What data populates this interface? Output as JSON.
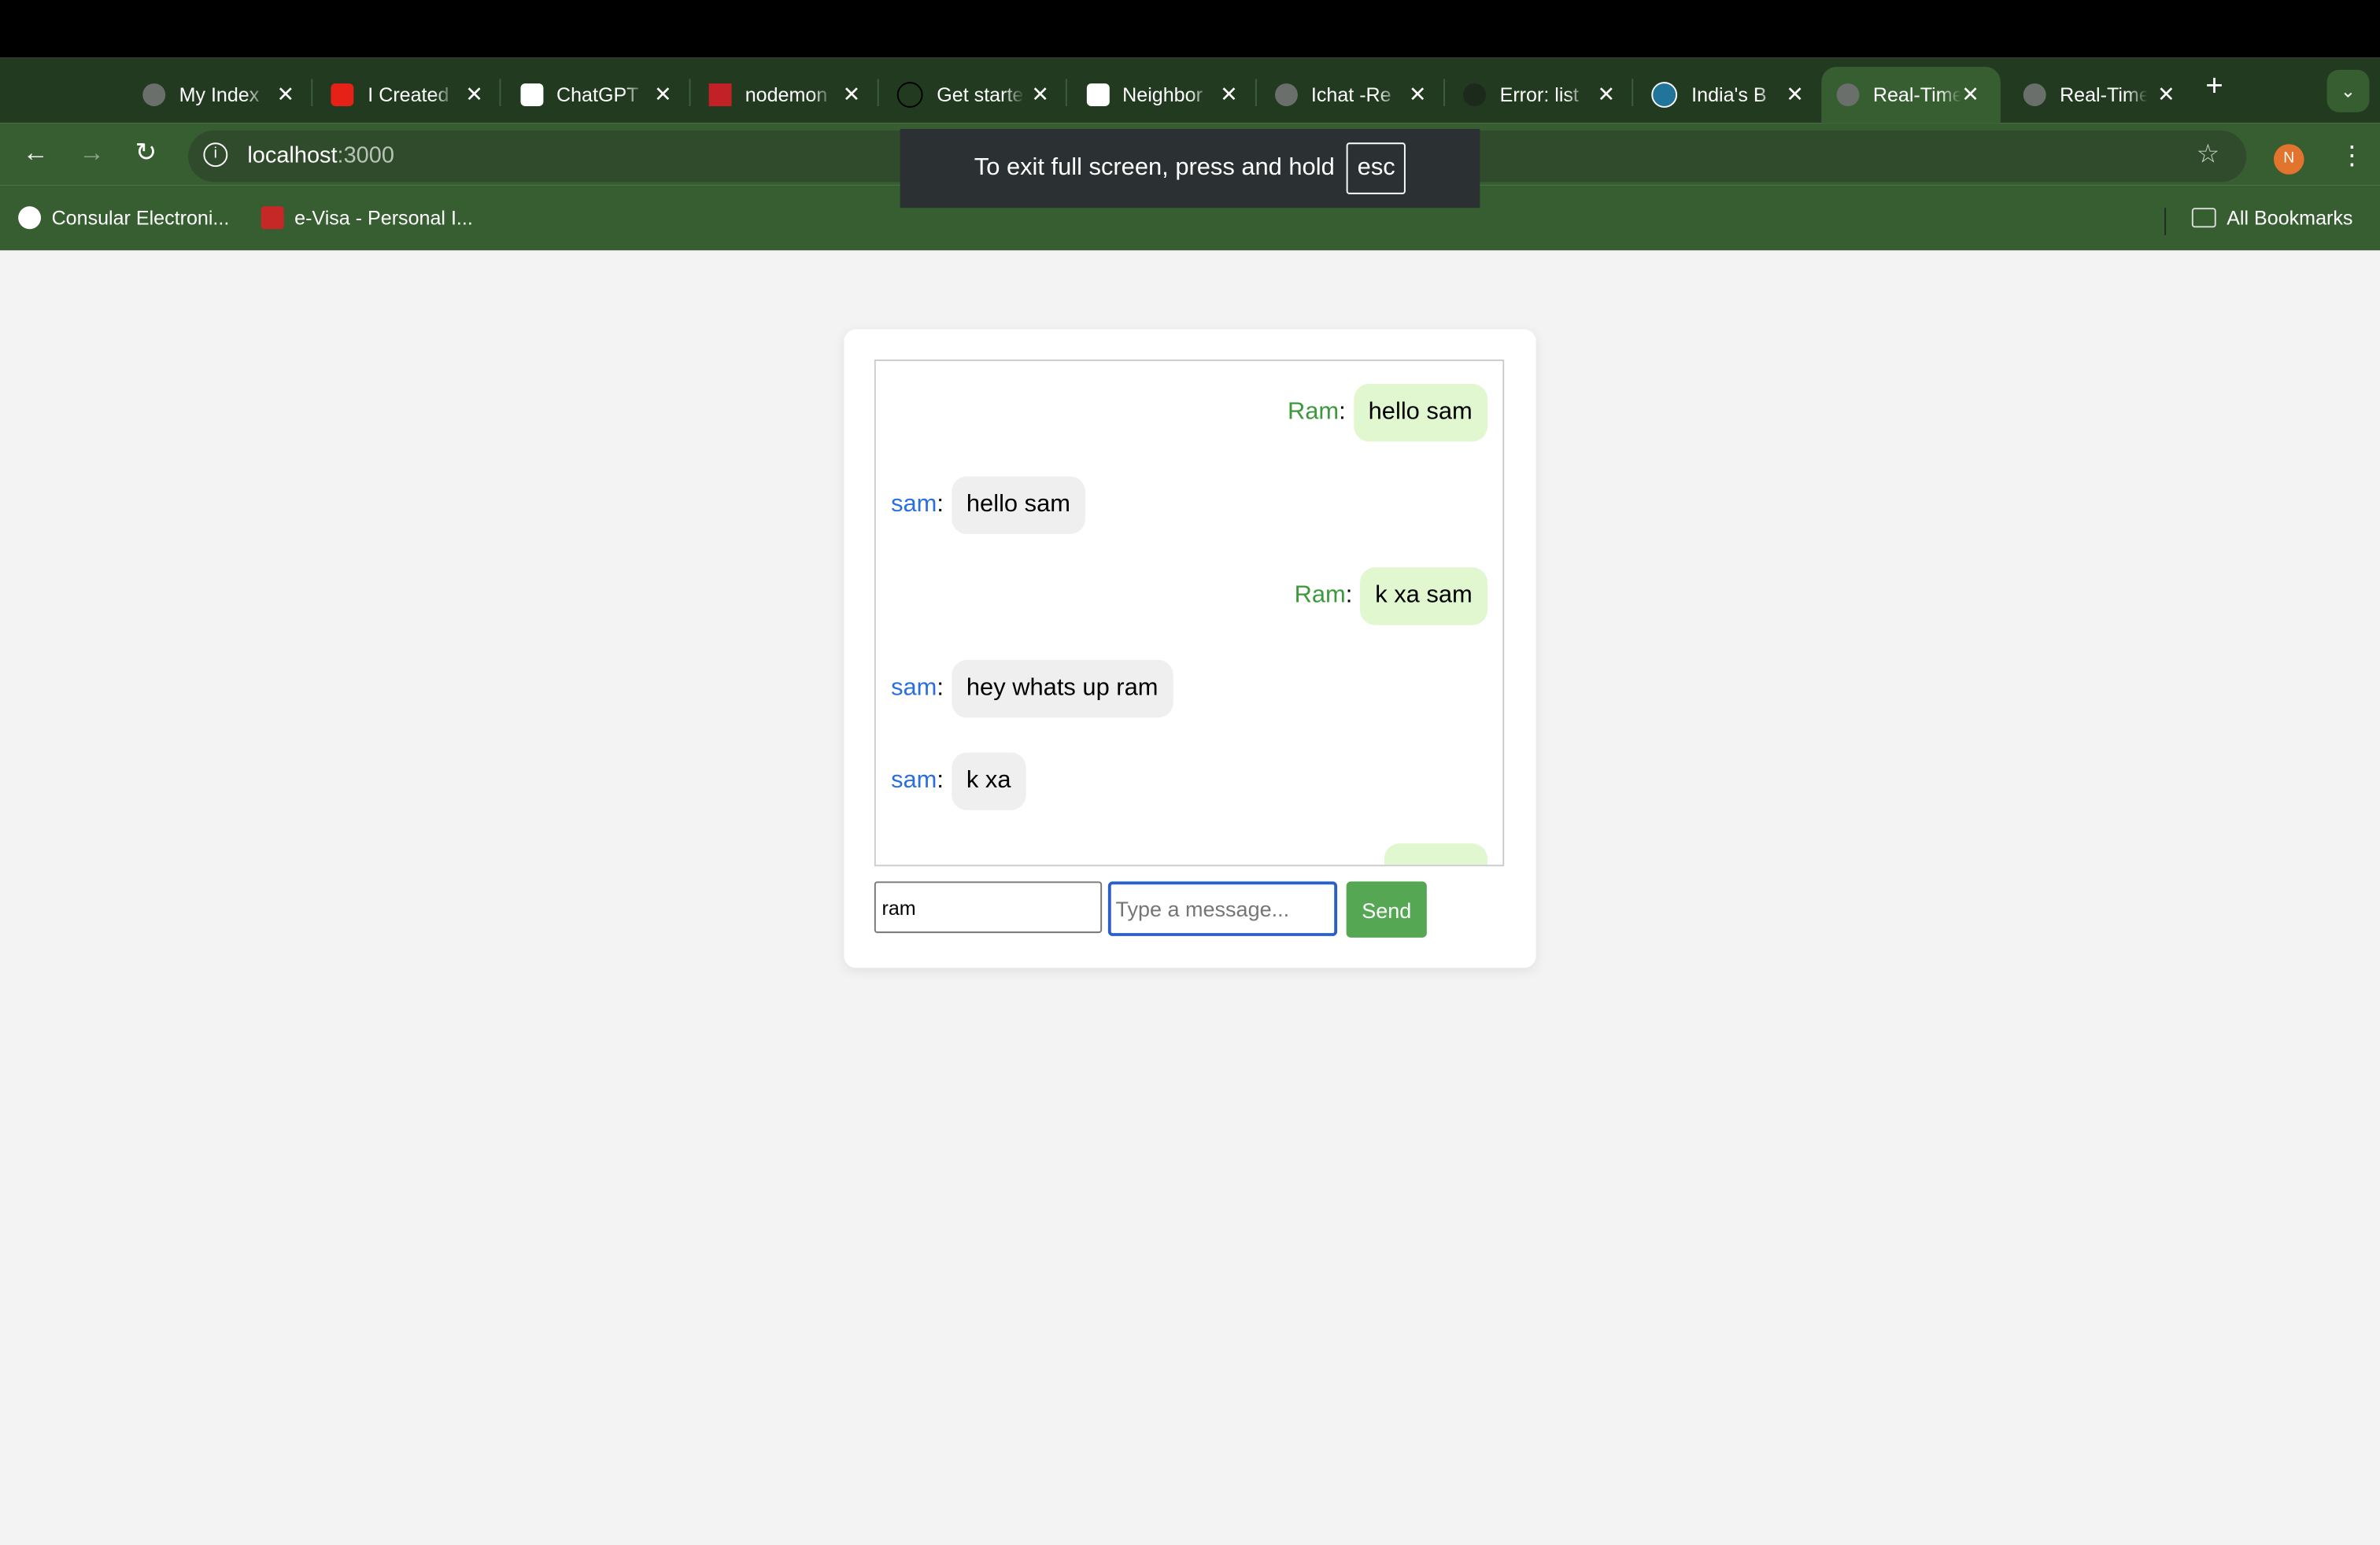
{
  "browser": {
    "tabs": [
      {
        "label": "My Index",
        "icon": "globe-icon",
        "active": false
      },
      {
        "label": "I Created",
        "icon": "youtube-icon",
        "active": false
      },
      {
        "label": "ChatGPT",
        "icon": "chatgpt-icon",
        "active": false
      },
      {
        "label": "nodemon",
        "icon": "npm-icon",
        "active": false
      },
      {
        "label": "Get started",
        "icon": "bolt-icon",
        "active": false
      },
      {
        "label": "Neighbor",
        "icon": "chatgpt-icon",
        "active": false
      },
      {
        "label": "Ichat -Re",
        "icon": "globe-icon",
        "active": false
      },
      {
        "label": "Error: list",
        "icon": "github-icon",
        "active": false
      },
      {
        "label": "India's B",
        "icon": "wordpress-icon",
        "active": false
      },
      {
        "label": "Real-Time",
        "icon": "globe-icon",
        "active": true
      },
      {
        "label": "Real-Time",
        "icon": "globe-icon",
        "active": false
      }
    ],
    "close_glyph": "✕",
    "new_tab": "+",
    "url_host": "localhost",
    "url_port": ":3000",
    "avatar_initial": "N",
    "bookmarks": [
      {
        "label": "Consular Electroni...",
        "color": "#ffffff"
      },
      {
        "label": "e-Visa - Personal I...",
        "color": "#c62828"
      }
    ],
    "all_bookmarks": "All Bookmarks",
    "fullscreen_notice": "To exit full screen, press and hold",
    "fullscreen_key": "esc"
  },
  "chat": {
    "messages": [
      {
        "sender": "Ram",
        "text": "hello sam",
        "side": "right"
      },
      {
        "sender": "sam",
        "text": "hello sam",
        "side": "left"
      },
      {
        "sender": "Ram",
        "text": "k xa sam",
        "side": "right"
      },
      {
        "sender": "sam",
        "text": "hey whats up ram",
        "side": "left"
      },
      {
        "sender": "sam",
        "text": "k xa",
        "side": "left"
      }
    ],
    "name_value": "ram",
    "message_placeholder": "Type a message...",
    "send_label": "Send"
  }
}
